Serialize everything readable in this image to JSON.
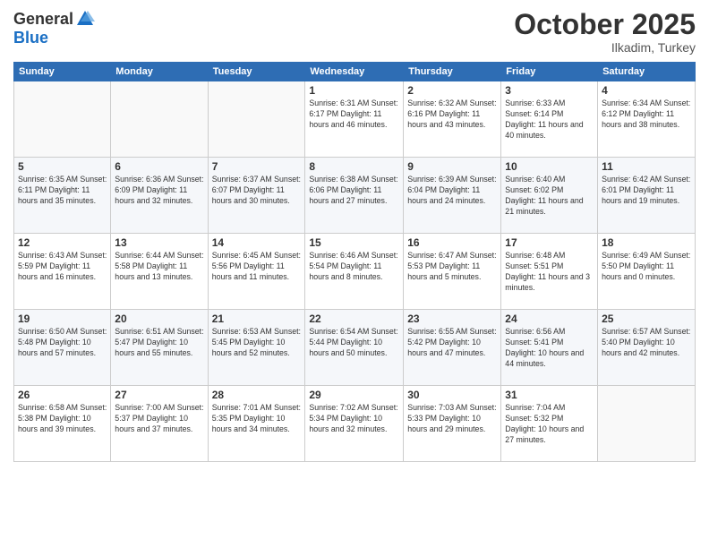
{
  "header": {
    "logo_general": "General",
    "logo_blue": "Blue",
    "title": "October 2025",
    "subtitle": "Ilkadim, Turkey"
  },
  "weekdays": [
    "Sunday",
    "Monday",
    "Tuesday",
    "Wednesday",
    "Thursday",
    "Friday",
    "Saturday"
  ],
  "weeks": [
    [
      {
        "day": "",
        "info": ""
      },
      {
        "day": "",
        "info": ""
      },
      {
        "day": "",
        "info": ""
      },
      {
        "day": "1",
        "info": "Sunrise: 6:31 AM\nSunset: 6:17 PM\nDaylight: 11 hours\nand 46 minutes."
      },
      {
        "day": "2",
        "info": "Sunrise: 6:32 AM\nSunset: 6:16 PM\nDaylight: 11 hours\nand 43 minutes."
      },
      {
        "day": "3",
        "info": "Sunrise: 6:33 AM\nSunset: 6:14 PM\nDaylight: 11 hours\nand 40 minutes."
      },
      {
        "day": "4",
        "info": "Sunrise: 6:34 AM\nSunset: 6:12 PM\nDaylight: 11 hours\nand 38 minutes."
      }
    ],
    [
      {
        "day": "5",
        "info": "Sunrise: 6:35 AM\nSunset: 6:11 PM\nDaylight: 11 hours\nand 35 minutes."
      },
      {
        "day": "6",
        "info": "Sunrise: 6:36 AM\nSunset: 6:09 PM\nDaylight: 11 hours\nand 32 minutes."
      },
      {
        "day": "7",
        "info": "Sunrise: 6:37 AM\nSunset: 6:07 PM\nDaylight: 11 hours\nand 30 minutes."
      },
      {
        "day": "8",
        "info": "Sunrise: 6:38 AM\nSunset: 6:06 PM\nDaylight: 11 hours\nand 27 minutes."
      },
      {
        "day": "9",
        "info": "Sunrise: 6:39 AM\nSunset: 6:04 PM\nDaylight: 11 hours\nand 24 minutes."
      },
      {
        "day": "10",
        "info": "Sunrise: 6:40 AM\nSunset: 6:02 PM\nDaylight: 11 hours\nand 21 minutes."
      },
      {
        "day": "11",
        "info": "Sunrise: 6:42 AM\nSunset: 6:01 PM\nDaylight: 11 hours\nand 19 minutes."
      }
    ],
    [
      {
        "day": "12",
        "info": "Sunrise: 6:43 AM\nSunset: 5:59 PM\nDaylight: 11 hours\nand 16 minutes."
      },
      {
        "day": "13",
        "info": "Sunrise: 6:44 AM\nSunset: 5:58 PM\nDaylight: 11 hours\nand 13 minutes."
      },
      {
        "day": "14",
        "info": "Sunrise: 6:45 AM\nSunset: 5:56 PM\nDaylight: 11 hours\nand 11 minutes."
      },
      {
        "day": "15",
        "info": "Sunrise: 6:46 AM\nSunset: 5:54 PM\nDaylight: 11 hours\nand 8 minutes."
      },
      {
        "day": "16",
        "info": "Sunrise: 6:47 AM\nSunset: 5:53 PM\nDaylight: 11 hours\nand 5 minutes."
      },
      {
        "day": "17",
        "info": "Sunrise: 6:48 AM\nSunset: 5:51 PM\nDaylight: 11 hours\nand 3 minutes."
      },
      {
        "day": "18",
        "info": "Sunrise: 6:49 AM\nSunset: 5:50 PM\nDaylight: 11 hours\nand 0 minutes."
      }
    ],
    [
      {
        "day": "19",
        "info": "Sunrise: 6:50 AM\nSunset: 5:48 PM\nDaylight: 10 hours\nand 57 minutes."
      },
      {
        "day": "20",
        "info": "Sunrise: 6:51 AM\nSunset: 5:47 PM\nDaylight: 10 hours\nand 55 minutes."
      },
      {
        "day": "21",
        "info": "Sunrise: 6:53 AM\nSunset: 5:45 PM\nDaylight: 10 hours\nand 52 minutes."
      },
      {
        "day": "22",
        "info": "Sunrise: 6:54 AM\nSunset: 5:44 PM\nDaylight: 10 hours\nand 50 minutes."
      },
      {
        "day": "23",
        "info": "Sunrise: 6:55 AM\nSunset: 5:42 PM\nDaylight: 10 hours\nand 47 minutes."
      },
      {
        "day": "24",
        "info": "Sunrise: 6:56 AM\nSunset: 5:41 PM\nDaylight: 10 hours\nand 44 minutes."
      },
      {
        "day": "25",
        "info": "Sunrise: 6:57 AM\nSunset: 5:40 PM\nDaylight: 10 hours\nand 42 minutes."
      }
    ],
    [
      {
        "day": "26",
        "info": "Sunrise: 6:58 AM\nSunset: 5:38 PM\nDaylight: 10 hours\nand 39 minutes."
      },
      {
        "day": "27",
        "info": "Sunrise: 7:00 AM\nSunset: 5:37 PM\nDaylight: 10 hours\nand 37 minutes."
      },
      {
        "day": "28",
        "info": "Sunrise: 7:01 AM\nSunset: 5:35 PM\nDaylight: 10 hours\nand 34 minutes."
      },
      {
        "day": "29",
        "info": "Sunrise: 7:02 AM\nSunset: 5:34 PM\nDaylight: 10 hours\nand 32 minutes."
      },
      {
        "day": "30",
        "info": "Sunrise: 7:03 AM\nSunset: 5:33 PM\nDaylight: 10 hours\nand 29 minutes."
      },
      {
        "day": "31",
        "info": "Sunrise: 7:04 AM\nSunset: 5:32 PM\nDaylight: 10 hours\nand 27 minutes."
      },
      {
        "day": "",
        "info": ""
      }
    ]
  ]
}
